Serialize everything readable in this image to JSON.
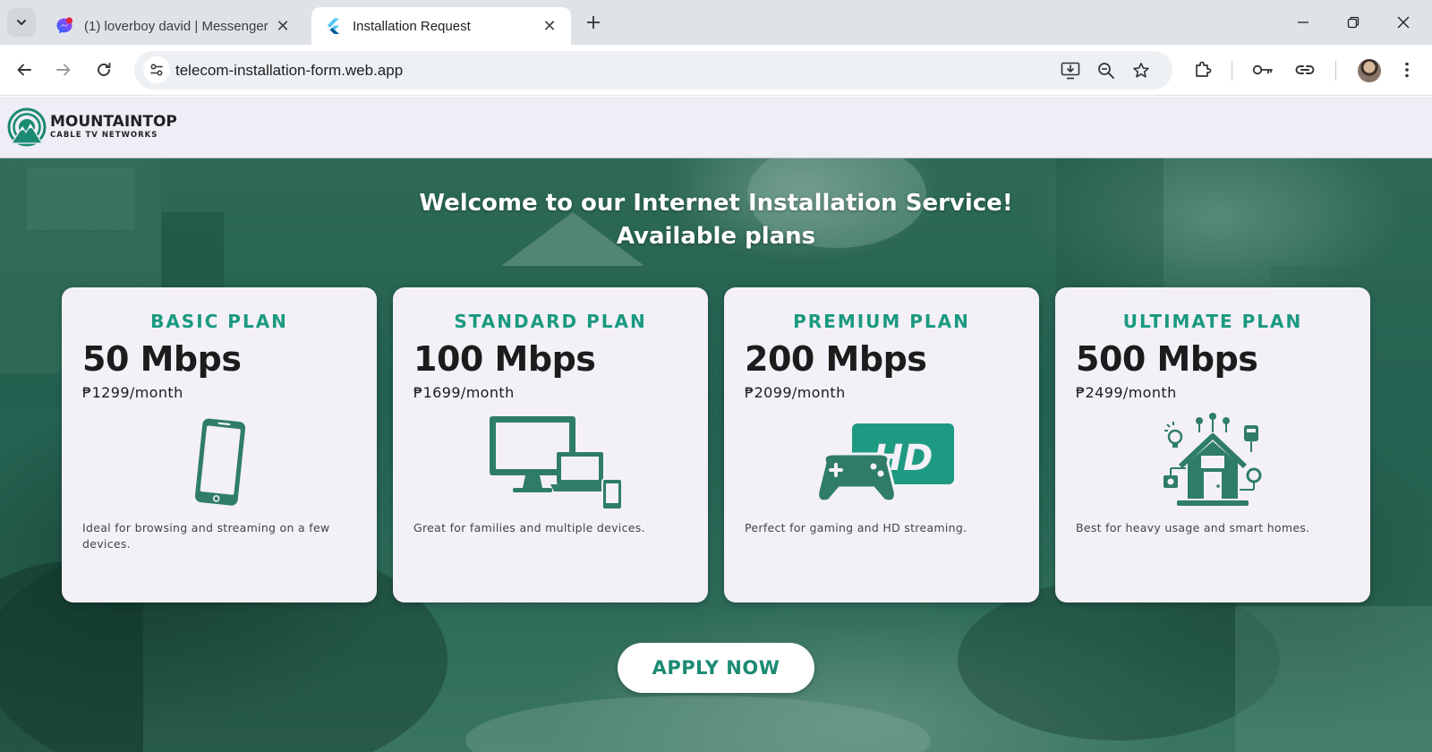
{
  "browser": {
    "tabs": [
      {
        "title": "(1) loverboy david | Messenger",
        "favicon": "messenger-icon",
        "active": false
      },
      {
        "title": "Installation Request",
        "favicon": "flutter-icon",
        "active": true
      }
    ],
    "address_bar": {
      "url": "telecom-installation-form.web.app"
    }
  },
  "site": {
    "logo": {
      "name": "MOUNTAINTOP",
      "subtitle": "CABLE TV NETWORKS"
    },
    "hero": {
      "title_line1": "Welcome to our Internet Installation Service!",
      "title_line2": "Available plans"
    },
    "plans": [
      {
        "name": "BASIC PLAN",
        "speed": "50 Mbps",
        "price": "₱1299/month",
        "icon": "smartphone-icon",
        "description": "Ideal for browsing and streaming on a few devices."
      },
      {
        "name": "STANDARD PLAN",
        "speed": "100 Mbps",
        "price": "₱1699/month",
        "icon": "multi-device-icon",
        "description": "Great for families and multiple devices."
      },
      {
        "name": "PREMIUM PLAN",
        "speed": "200 Mbps",
        "price": "₱2099/month",
        "icon": "gamepad-hd-icon",
        "hd_label": "HD",
        "description": "Perfect for gaming and HD streaming."
      },
      {
        "name": "ULTIMATE PLAN",
        "speed": "500 Mbps",
        "price": "₱2499/month",
        "icon": "smart-home-icon",
        "description": "Best for heavy usage and smart homes."
      }
    ],
    "apply_button": "APPLY NOW"
  },
  "colors": {
    "accent": "#1a9a80",
    "illustration": "#2f7d68",
    "hero_overlay": "#236150",
    "card_bg": "#f4f0f7"
  }
}
